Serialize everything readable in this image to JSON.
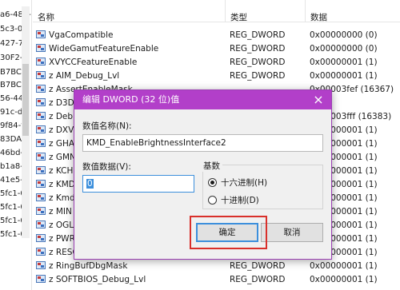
{
  "tree": {
    "items": [
      "a6-488-b",
      "5c3-0",
      "427-76",
      "30F2-",
      "B7BC-",
      "B7BC-",
      "56-44",
      "91c-d",
      "9f84-t",
      "83DA-",
      "46bd-",
      "b1a8-",
      "41e5-0",
      "5fc1-0",
      "5fc1-0",
      "5fc1-0",
      "5fc1-0"
    ]
  },
  "list": {
    "headers": {
      "name": "名称",
      "type": "类型",
      "data": "数据"
    },
    "rows": [
      {
        "name": "VgaCompatible",
        "type": "REG_DWORD",
        "data": "0x00000000 (0)"
      },
      {
        "name": "WideGamutFeatureEnable",
        "type": "REG_DWORD",
        "data": "0x00000000 (0)"
      },
      {
        "name": "XVYCCFeatureEnable",
        "type": "REG_DWORD",
        "data": "0x00000001 (1)"
      },
      {
        "name": "z AIM_Debug_Lvl",
        "type": "REG_DWORD",
        "data": "0x00000001 (1)"
      },
      {
        "name": "z AssertEnableMask",
        "type": "",
        "data": "0x00003fef (16367)"
      },
      {
        "name": "z D3D",
        "type": "",
        "data": ""
      },
      {
        "name": "z Deb",
        "type": "",
        "data": "0x00003fff (16383)"
      },
      {
        "name": "z DXV",
        "type": "",
        "data": "0x00000001 (1)"
      },
      {
        "name": "z GHA",
        "type": "",
        "data": "0x00000001 (1)"
      },
      {
        "name": "z GMN",
        "type": "",
        "data": "0x00000001 (1)"
      },
      {
        "name": "z KCH",
        "type": "",
        "data": "0x00000001 (1)"
      },
      {
        "name": "z KMD",
        "type": "",
        "data": "0x00000001 (1)"
      },
      {
        "name": "z Kmd",
        "type": "",
        "data": "0x00000001 (1)"
      },
      {
        "name": "z MIN",
        "type": "",
        "data": "0x00000001 (1)"
      },
      {
        "name": "z OGL",
        "type": "",
        "data": "0x00000001 (1)"
      },
      {
        "name": "z PWR",
        "type": "",
        "data": "0x00000001 (1)"
      },
      {
        "name": "z RESOURCEMANAGER_Debug_Lvl",
        "type": "REG_DWORD",
        "data": "0x00000001 (1)"
      },
      {
        "name": "z RingBufDbgMask",
        "type": "REG_DWORD",
        "data": "0x00000001 (1)"
      },
      {
        "name": "z SOFTBIOS_Debug_Lvl",
        "type": "REG_DWORD",
        "data": "0x00000001 (1)"
      }
    ]
  },
  "dialog": {
    "title": "编辑 DWORD (32 位)值",
    "close_glyph": "×",
    "value_name_label": "数值名称(N):",
    "value_name": "KMD_EnableBrightnessInterface2",
    "value_data_label": "数值数据(V):",
    "value_data": "0",
    "base_label": "基数",
    "radio_hex": "十六进制(H)",
    "radio_dec": "十进制(D)",
    "ok_label": "确定",
    "cancel_label": "取消"
  },
  "colors": {
    "title_bar": "#b23fc9",
    "highlight_box": "#d9302b",
    "focus_blue": "#3c8fdc"
  }
}
